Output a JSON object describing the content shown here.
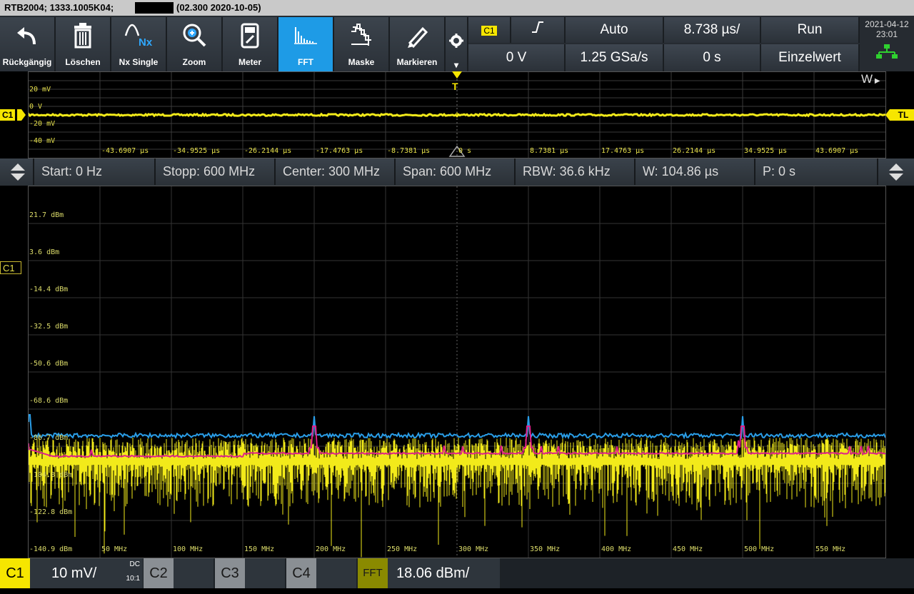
{
  "title": {
    "device": "RTB2004; 1333.1005K04;",
    "firmware": "(02.300 2020-10-05)"
  },
  "toolbar": {
    "buttons": [
      {
        "label": "Rückgängig",
        "icon": "undo-icon"
      },
      {
        "label": "Löschen",
        "icon": "trash-icon"
      },
      {
        "label": "Nx Single",
        "icon": "nx-single-icon",
        "icon_text": "Nx"
      },
      {
        "label": "Zoom",
        "icon": "zoom-icon"
      },
      {
        "label": "Meter",
        "icon": "meter-icon"
      },
      {
        "label": "FFT",
        "icon": "fft-icon"
      },
      {
        "label": "Maske",
        "icon": "mask-icon"
      },
      {
        "label": "Markieren",
        "icon": "marker-pen-icon"
      }
    ],
    "trigger_source": "C1",
    "trigger_level": "0 V",
    "trigger_mode": "Auto",
    "sample_rate": "1.25 GSa/s",
    "timebase": "8.738 µs/",
    "time_offset": "0 s",
    "acq_state": "Run",
    "acq_mode": "Einzelwert",
    "date": "2021-04-12",
    "time": "23:01"
  },
  "time_panel": {
    "y_labels": [
      "20 mV",
      "0 V",
      "-20 mV",
      "-40 mV"
    ],
    "x_labels": [
      "-43.6907 µs",
      "-34.9525 µs",
      "-26.2144 µs",
      "-17.4763 µs",
      "-8.7381 µs",
      "0 s",
      "8.7381 µs",
      "17.4763 µs",
      "26.2144 µs",
      "34.9525 µs",
      "43.6907 µs"
    ],
    "channel_marker": "C1",
    "trigger_level_marker": "TL",
    "trigger_marker": "T",
    "window_marker": "W"
  },
  "fft_info": {
    "start": "Start: 0 Hz",
    "stop": "Stopp: 600 MHz",
    "center": "Center: 300 MHz",
    "span": "Span: 600 MHz",
    "rbw": "RBW: 36.6 kHz",
    "window": "W: 104.86 µs",
    "position": "P: 0 s"
  },
  "fft_panel": {
    "y_labels": [
      "21.7 dBm",
      "3.6 dBm",
      "-14.4 dBm",
      "-32.5 dBm",
      "-50.6 dBm",
      "-68.6 dBm",
      "-86.7 dBm",
      "-104.8 dBm",
      "-122.8 dBm",
      "-140.9 dBm"
    ],
    "x_labels": [
      "50 MHz",
      "100 MHz",
      "150 MHz",
      "200 MHz",
      "250 MHz",
      "300 MHz",
      "350 MHz",
      "400 MHz",
      "450 MHz",
      "500 MHz",
      "550 MHz"
    ],
    "channel_marker": "C1",
    "colors": {
      "live": "#f2ea1a",
      "max_hold": "#2a9ee8",
      "average": "#e0208a"
    }
  },
  "bottom": {
    "c1_label": "C1",
    "c1_scale": "10 mV/",
    "c1_coupling": "DC",
    "c1_probe": "10:1",
    "c2_label": "C2",
    "c3_label": "C3",
    "c4_label": "C4",
    "fft_label": "FFT",
    "fft_scale": "18.06 dBm/"
  }
}
